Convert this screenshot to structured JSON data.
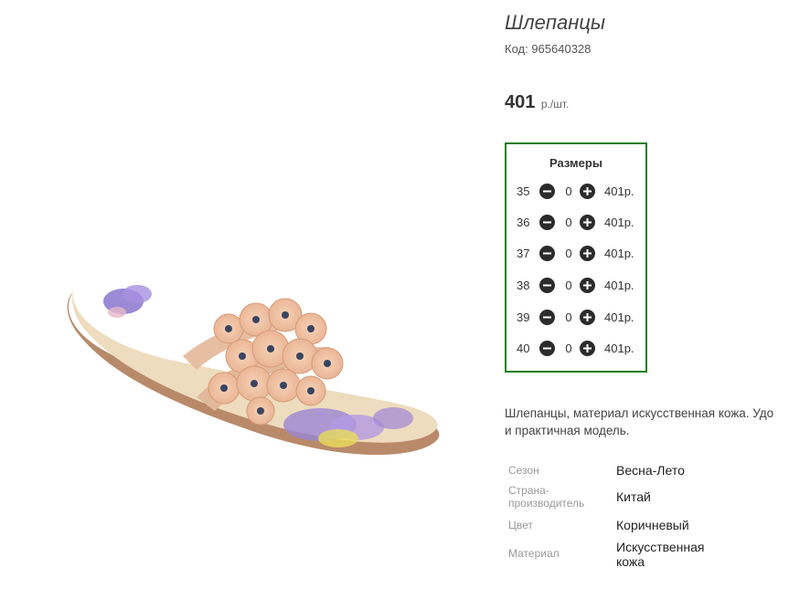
{
  "product": {
    "title": "Шлепанцы",
    "code": "Код: 965640328",
    "price_value": "401",
    "price_unit": "р./шт.",
    "image": "sandal-photo"
  },
  "sizes": {
    "title": "Размеры",
    "rows": [
      {
        "size": "35",
        "qty": "0",
        "price": "401р."
      },
      {
        "size": "36",
        "qty": "0",
        "price": "401р."
      },
      {
        "size": "37",
        "qty": "0",
        "price": "401р."
      },
      {
        "size": "38",
        "qty": "0",
        "price": "401р."
      },
      {
        "size": "39",
        "qty": "0",
        "price": "401р."
      },
      {
        "size": "40",
        "qty": "0",
        "price": "401р."
      }
    ],
    "minus_icon": "minus-circle-icon",
    "plus_icon": "plus-circle-icon",
    "border_color": "#1a7f1a"
  },
  "description": {
    "line1": "Шлепанцы, материал искусственная кожа. Удо",
    "line2": "и практичная модель."
  },
  "attributes": [
    {
      "label_lines": [
        "Сезон"
      ],
      "value_lines": [
        "Весна-Лето"
      ]
    },
    {
      "label_lines": [
        "Страна-",
        "производитель"
      ],
      "value_lines": [
        "Китай"
      ]
    },
    {
      "label_lines": [
        "Цвет"
      ],
      "value_lines": [
        "Коричневый"
      ]
    },
    {
      "label_lines": [
        "Материал"
      ],
      "value_lines": [
        "Искусственная",
        "кожа"
      ]
    }
  ]
}
